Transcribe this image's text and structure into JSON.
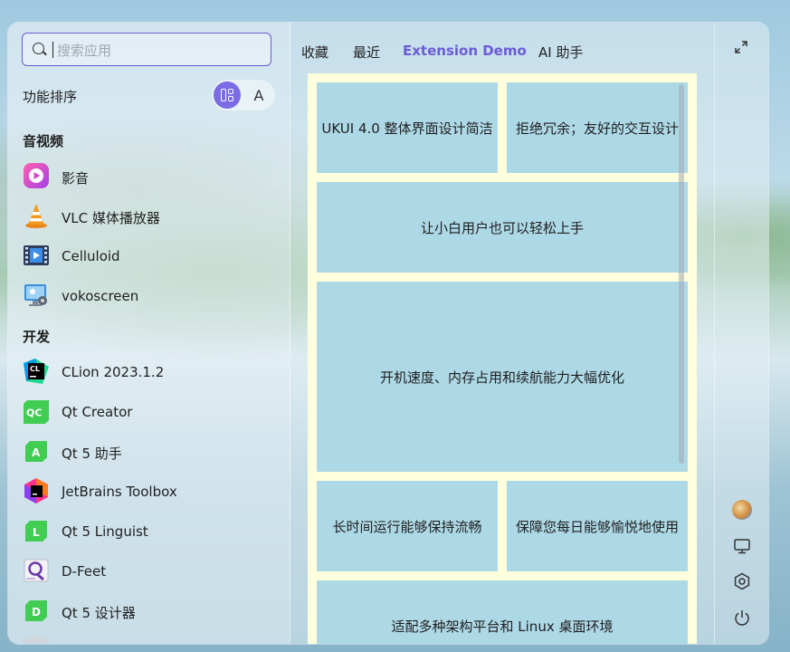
{
  "search": {
    "placeholder": "搜索应用",
    "value": ""
  },
  "sort": {
    "label": "功能排序",
    "alpha_label": "A"
  },
  "sections": [
    {
      "title": "音视频"
    },
    {
      "title": "开发"
    }
  ],
  "apps": [
    {
      "name": "影音",
      "icon": "kylin-video-icon"
    },
    {
      "name": "VLC 媒体播放器",
      "icon": "vlc-icon"
    },
    {
      "name": "Celluloid",
      "icon": "celluloid-icon"
    },
    {
      "name": "vokoscreen",
      "icon": "vokoscreen-icon"
    },
    {
      "name": "CLion 2023.1.2",
      "icon": "clion-icon",
      "badge": "CL"
    },
    {
      "name": "Qt Creator",
      "icon": "qt-creator-icon",
      "badge": "QC"
    },
    {
      "name": "Qt 5 助手",
      "icon": "qt-assistant-icon",
      "badge": "A"
    },
    {
      "name": "JetBrains Toolbox",
      "icon": "jetbrains-toolbox-icon"
    },
    {
      "name": "Qt 5 Linguist",
      "icon": "qt-linguist-icon",
      "badge": "L"
    },
    {
      "name": "D-Feet",
      "icon": "d-feet-icon"
    },
    {
      "name": "Qt 5 设计器",
      "icon": "qt-designer-icon",
      "badge": "D"
    }
  ],
  "tabs": [
    {
      "label": "收藏"
    },
    {
      "label": "最近"
    },
    {
      "label": "Extension Demo",
      "active": true
    },
    {
      "label": "AI 助手"
    }
  ],
  "cards": [
    {
      "text": "UKUI 4.0 整体界面设计简洁"
    },
    {
      "text": "拒绝冗余；友好的交互设计"
    },
    {
      "text": "让小白用户也可以轻松上手"
    },
    {
      "text": "开机速度、内存占用和续航能力大幅优化"
    },
    {
      "text": "长时间运行能够保持流畅"
    },
    {
      "text": "保障您每日能够愉悦地使用"
    },
    {
      "text": "适配多种架构平台和 Linux 桌面环境"
    }
  ],
  "colors": {
    "accent": "#6b5cd6",
    "card": "#add8e6",
    "canvas": "#ffffdd"
  },
  "rail_icons": [
    "user-avatar-icon",
    "computer-icon",
    "settings-icon",
    "power-icon"
  ]
}
